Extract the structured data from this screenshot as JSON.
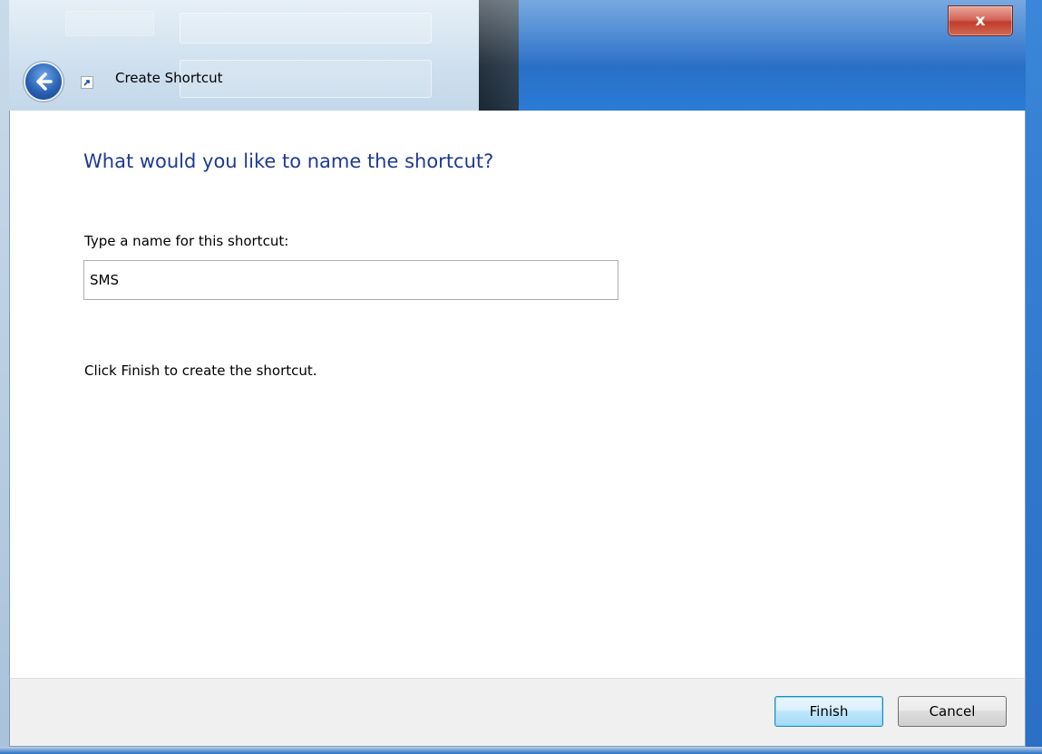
{
  "window": {
    "title": "Create Shortcut",
    "close_label": "x"
  },
  "content": {
    "heading": "What would you like to name the shortcut?",
    "name_label": "Type a name for this shortcut:",
    "name_value": "SMS",
    "hint": "Click Finish to create the shortcut."
  },
  "footer": {
    "finish_label": "Finish",
    "cancel_label": "Cancel"
  },
  "colors": {
    "heading": "#1e3a95",
    "close_button": "#c23c2d",
    "default_button_border": "#3c7fb1"
  },
  "icons": {
    "back": "back-arrow-icon",
    "shortcut": "shortcut-arrow-icon",
    "close": "close-icon"
  }
}
